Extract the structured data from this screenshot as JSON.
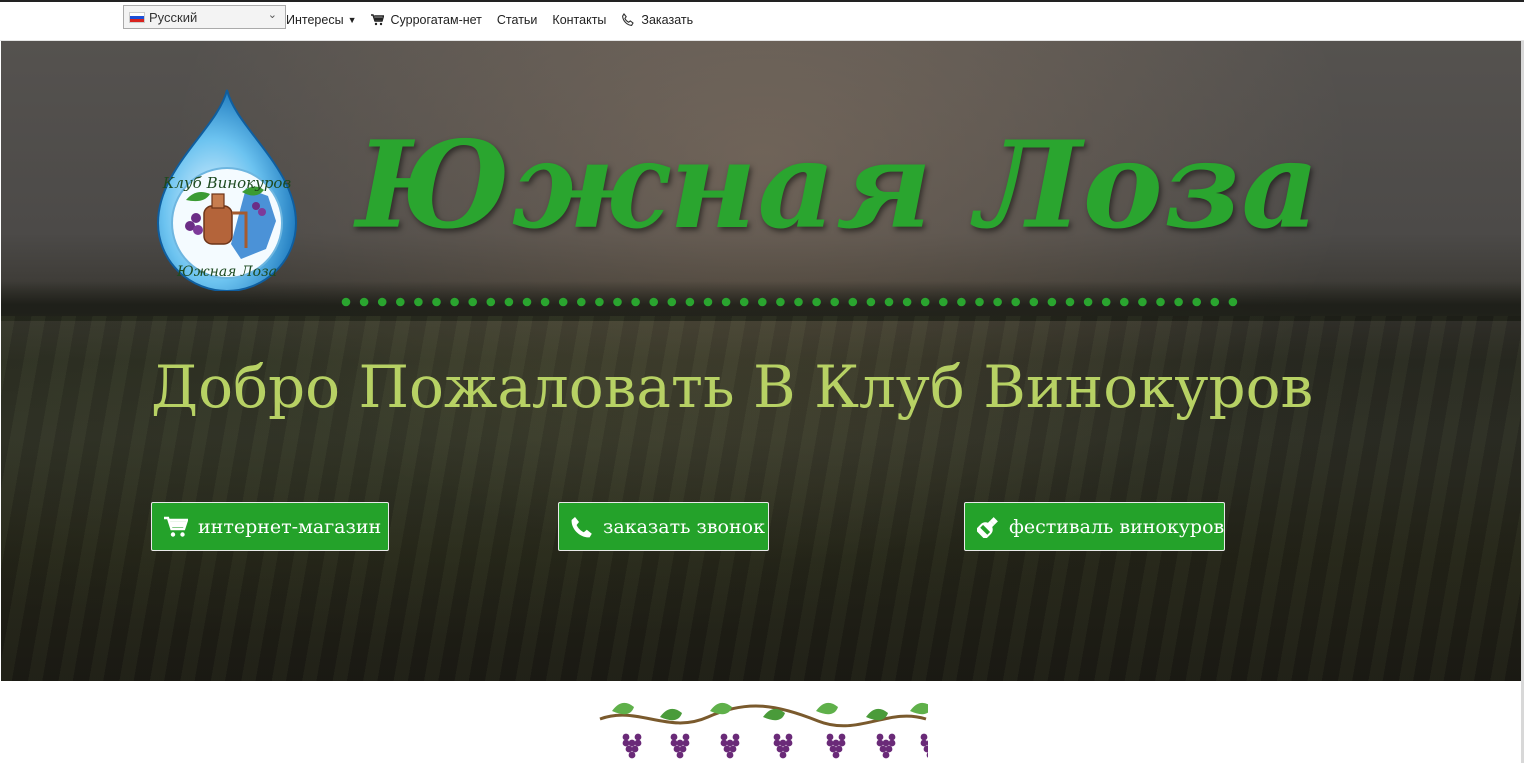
{
  "language": {
    "selected": "Русский",
    "flag_icon": "russia-flag-icon"
  },
  "nav": {
    "items": [
      {
        "label": "Интересы",
        "has_dropdown": true
      },
      {
        "label": "Суррогатам-нет",
        "icon": "cart-icon"
      },
      {
        "label": "Статьи"
      },
      {
        "label": "Контакты"
      },
      {
        "label": "Заказать",
        "icon": "phone-icon"
      }
    ]
  },
  "hero": {
    "logo_text_top": "Клуб Винокуров",
    "logo_text_bottom": "Южная Лоза",
    "brand": "Южная Лоза",
    "welcome": "Добро Пожаловать В Клуб Винокуров",
    "buttons": [
      {
        "label": "интернет-магазин",
        "icon": "cart-icon"
      },
      {
        "label": "заказать звонок",
        "icon": "phone-icon"
      },
      {
        "label": "фестиваль винокуров",
        "icon": "wine-bottle-icon"
      }
    ]
  },
  "colors": {
    "brand_green": "#2aa52f",
    "welcome_green": "#b7d164",
    "button_green": "#24a22a"
  }
}
